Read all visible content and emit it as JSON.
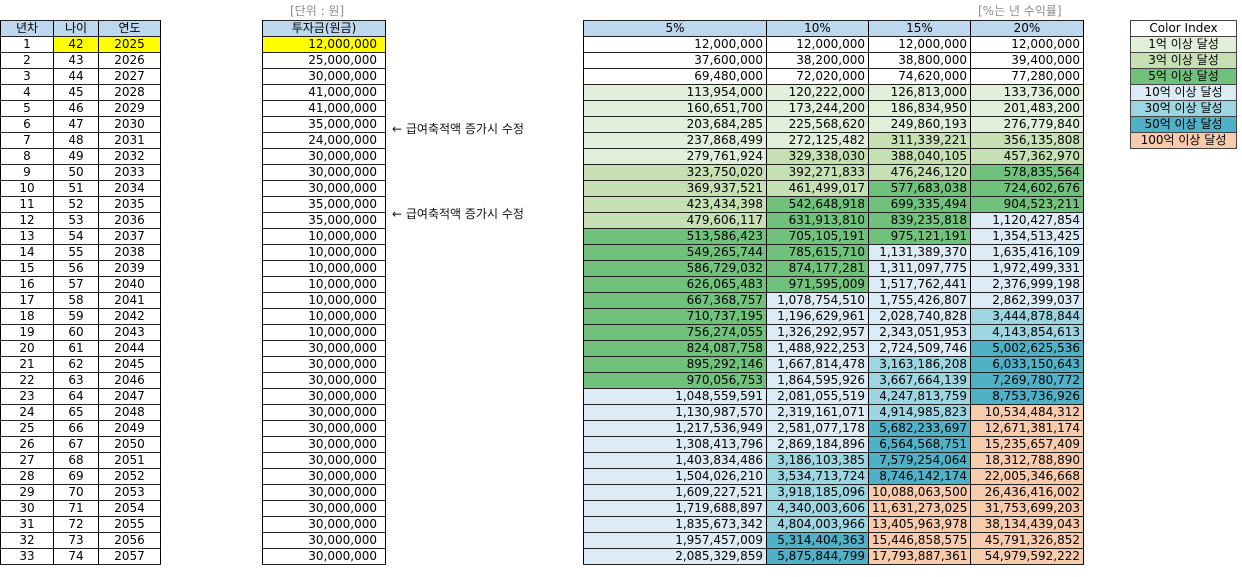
{
  "notes": {
    "unit": "[단위 : 원]",
    "pct": "[%는 년 수익률]"
  },
  "headers": {
    "year_no": "년차",
    "age": "나이",
    "year": "연도",
    "invest": "투자금(원금)",
    "rates": [
      "5%",
      "10%",
      "15%",
      "20%"
    ]
  },
  "side_notes": [
    {
      "row": 6,
      "text": "← 급여축적액 증가시 수정"
    },
    {
      "row": 11,
      "text": "← 급여축적액 증가시 수정"
    }
  ],
  "colors": {
    "1억": "#e2efda",
    "3억": "#c6e0b4",
    "5억": "#70c17c",
    "10억": "#ddebf7",
    "30억": "#9dd5e0",
    "50억": "#4fb0c6",
    "100억": "#f8cbad",
    "header": "#bdd7ee",
    "highlight": "#ffff00"
  },
  "color_index": {
    "title": "Color Index",
    "items": [
      {
        "key": "1억",
        "label": "1억 이상 달성"
      },
      {
        "key": "3억",
        "label": "3억 이상 달성"
      },
      {
        "key": "5억",
        "label": "5억 이상 달성"
      },
      {
        "key": "10억",
        "label": "10억 이상 달성"
      },
      {
        "key": "30억",
        "label": "30억 이상 달성"
      },
      {
        "key": "50억",
        "label": "50억 이상 달성"
      },
      {
        "key": "100억",
        "label": "100억 이상 달성"
      }
    ]
  },
  "rows": [
    {
      "n": "1",
      "age": "42",
      "year": "2025",
      "invest": "12,000,000",
      "hl": true,
      "v": [
        [
          "12,000,000",
          ""
        ],
        [
          "12,000,000",
          ""
        ],
        [
          "12,000,000",
          ""
        ],
        [
          "12,000,000",
          ""
        ]
      ]
    },
    {
      "n": "2",
      "age": "43",
      "year": "2026",
      "invest": "25,000,000",
      "v": [
        [
          "37,600,000",
          ""
        ],
        [
          "38,200,000",
          ""
        ],
        [
          "38,800,000",
          ""
        ],
        [
          "39,400,000",
          ""
        ]
      ]
    },
    {
      "n": "3",
      "age": "44",
      "year": "2027",
      "invest": "30,000,000",
      "v": [
        [
          "69,480,000",
          ""
        ],
        [
          "72,020,000",
          ""
        ],
        [
          "74,620,000",
          ""
        ],
        [
          "77,280,000",
          ""
        ]
      ]
    },
    {
      "n": "4",
      "age": "45",
      "year": "2028",
      "invest": "41,000,000",
      "v": [
        [
          "113,954,000",
          "1억"
        ],
        [
          "120,222,000",
          "1억"
        ],
        [
          "126,813,000",
          "1억"
        ],
        [
          "133,736,000",
          "1억"
        ]
      ]
    },
    {
      "n": "5",
      "age": "46",
      "year": "2029",
      "invest": "41,000,000",
      "v": [
        [
          "160,651,700",
          "1억"
        ],
        [
          "173,244,200",
          "1억"
        ],
        [
          "186,834,950",
          "1억"
        ],
        [
          "201,483,200",
          "1억"
        ]
      ]
    },
    {
      "n": "6",
      "age": "47",
      "year": "2030",
      "invest": "35,000,000",
      "v": [
        [
          "203,684,285",
          "1억"
        ],
        [
          "225,568,620",
          "1억"
        ],
        [
          "249,860,193",
          "1억"
        ],
        [
          "276,779,840",
          "1억"
        ]
      ]
    },
    {
      "n": "7",
      "age": "48",
      "year": "2031",
      "invest": "24,000,000",
      "v": [
        [
          "237,868,499",
          "1억"
        ],
        [
          "272,125,482",
          "1억"
        ],
        [
          "311,339,221",
          "3억"
        ],
        [
          "356,135,808",
          "3억"
        ]
      ]
    },
    {
      "n": "8",
      "age": "49",
      "year": "2032",
      "invest": "30,000,000",
      "v": [
        [
          "279,761,924",
          "1억"
        ],
        [
          "329,338,030",
          "3억"
        ],
        [
          "388,040,105",
          "3억"
        ],
        [
          "457,362,970",
          "3억"
        ]
      ]
    },
    {
      "n": "9",
      "age": "50",
      "year": "2033",
      "invest": "30,000,000",
      "v": [
        [
          "323,750,020",
          "3억"
        ],
        [
          "392,271,833",
          "3억"
        ],
        [
          "476,246,120",
          "3억"
        ],
        [
          "578,835,564",
          "5억"
        ]
      ]
    },
    {
      "n": "10",
      "age": "51",
      "year": "2034",
      "invest": "30,000,000",
      "v": [
        [
          "369,937,521",
          "3억"
        ],
        [
          "461,499,017",
          "3억"
        ],
        [
          "577,683,038",
          "5억"
        ],
        [
          "724,602,676",
          "5억"
        ]
      ]
    },
    {
      "n": "11",
      "age": "52",
      "year": "2035",
      "invest": "35,000,000",
      "v": [
        [
          "423,434,398",
          "3억"
        ],
        [
          "542,648,918",
          "5억"
        ],
        [
          "699,335,494",
          "5억"
        ],
        [
          "904,523,211",
          "5억"
        ]
      ]
    },
    {
      "n": "12",
      "age": "53",
      "year": "2036",
      "invest": "35,000,000",
      "v": [
        [
          "479,606,117",
          "3억"
        ],
        [
          "631,913,810",
          "5억"
        ],
        [
          "839,235,818",
          "5억"
        ],
        [
          "1,120,427,854",
          "10억"
        ]
      ]
    },
    {
      "n": "13",
      "age": "54",
      "year": "2037",
      "invest": "10,000,000",
      "v": [
        [
          "513,586,423",
          "5억"
        ],
        [
          "705,105,191",
          "5억"
        ],
        [
          "975,121,191",
          "5억"
        ],
        [
          "1,354,513,425",
          "10억"
        ]
      ]
    },
    {
      "n": "14",
      "age": "55",
      "year": "2038",
      "invest": "10,000,000",
      "v": [
        [
          "549,265,744",
          "5억"
        ],
        [
          "785,615,710",
          "5억"
        ],
        [
          "1,131,389,370",
          "10억"
        ],
        [
          "1,635,416,109",
          "10억"
        ]
      ]
    },
    {
      "n": "15",
      "age": "56",
      "year": "2039",
      "invest": "10,000,000",
      "v": [
        [
          "586,729,032",
          "5억"
        ],
        [
          "874,177,281",
          "5억"
        ],
        [
          "1,311,097,775",
          "10억"
        ],
        [
          "1,972,499,331",
          "10억"
        ]
      ]
    },
    {
      "n": "16",
      "age": "57",
      "year": "2040",
      "invest": "10,000,000",
      "v": [
        [
          "626,065,483",
          "5억"
        ],
        [
          "971,595,009",
          "5억"
        ],
        [
          "1,517,762,441",
          "10억"
        ],
        [
          "2,376,999,198",
          "10억"
        ]
      ]
    },
    {
      "n": "17",
      "age": "58",
      "year": "2041",
      "invest": "10,000,000",
      "v": [
        [
          "667,368,757",
          "5억"
        ],
        [
          "1,078,754,510",
          "10억"
        ],
        [
          "1,755,426,807",
          "10억"
        ],
        [
          "2,862,399,037",
          "10억"
        ]
      ]
    },
    {
      "n": "18",
      "age": "59",
      "year": "2042",
      "invest": "10,000,000",
      "v": [
        [
          "710,737,195",
          "5억"
        ],
        [
          "1,196,629,961",
          "10억"
        ],
        [
          "2,028,740,828",
          "10억"
        ],
        [
          "3,444,878,844",
          "30억"
        ]
      ]
    },
    {
      "n": "19",
      "age": "60",
      "year": "2043",
      "invest": "10,000,000",
      "v": [
        [
          "756,274,055",
          "5억"
        ],
        [
          "1,326,292,957",
          "10억"
        ],
        [
          "2,343,051,953",
          "10억"
        ],
        [
          "4,143,854,613",
          "30억"
        ]
      ]
    },
    {
      "n": "20",
      "age": "61",
      "year": "2044",
      "invest": "30,000,000",
      "v": [
        [
          "824,087,758",
          "5억"
        ],
        [
          "1,488,922,253",
          "10억"
        ],
        [
          "2,724,509,746",
          "10억"
        ],
        [
          "5,002,625,536",
          "50억"
        ]
      ]
    },
    {
      "n": "21",
      "age": "62",
      "year": "2045",
      "invest": "30,000,000",
      "v": [
        [
          "895,292,146",
          "5억"
        ],
        [
          "1,667,814,478",
          "10억"
        ],
        [
          "3,163,186,208",
          "30억"
        ],
        [
          "6,033,150,643",
          "50억"
        ]
      ]
    },
    {
      "n": "22",
      "age": "63",
      "year": "2046",
      "invest": "30,000,000",
      "v": [
        [
          "970,056,753",
          "5억"
        ],
        [
          "1,864,595,926",
          "10억"
        ],
        [
          "3,667,664,139",
          "30억"
        ],
        [
          "7,269,780,772",
          "50억"
        ]
      ]
    },
    {
      "n": "23",
      "age": "64",
      "year": "2047",
      "invest": "30,000,000",
      "v": [
        [
          "1,048,559,591",
          "10억"
        ],
        [
          "2,081,055,519",
          "10억"
        ],
        [
          "4,247,813,759",
          "30억"
        ],
        [
          "8,753,736,926",
          "50억"
        ]
      ]
    },
    {
      "n": "24",
      "age": "65",
      "year": "2048",
      "invest": "30,000,000",
      "v": [
        [
          "1,130,987,570",
          "10억"
        ],
        [
          "2,319,161,071",
          "10억"
        ],
        [
          "4,914,985,823",
          "30억"
        ],
        [
          "10,534,484,312",
          "100억"
        ]
      ]
    },
    {
      "n": "25",
      "age": "66",
      "year": "2049",
      "invest": "30,000,000",
      "v": [
        [
          "1,217,536,949",
          "10억"
        ],
        [
          "2,581,077,178",
          "10억"
        ],
        [
          "5,682,233,697",
          "50억"
        ],
        [
          "12,671,381,174",
          "100억"
        ]
      ]
    },
    {
      "n": "26",
      "age": "67",
      "year": "2050",
      "invest": "30,000,000",
      "v": [
        [
          "1,308,413,796",
          "10억"
        ],
        [
          "2,869,184,896",
          "10억"
        ],
        [
          "6,564,568,751",
          "50억"
        ],
        [
          "15,235,657,409",
          "100억"
        ]
      ]
    },
    {
      "n": "27",
      "age": "68",
      "year": "2051",
      "invest": "30,000,000",
      "v": [
        [
          "1,403,834,486",
          "10억"
        ],
        [
          "3,186,103,385",
          "30억"
        ],
        [
          "7,579,254,064",
          "50억"
        ],
        [
          "18,312,788,890",
          "100억"
        ]
      ]
    },
    {
      "n": "28",
      "age": "69",
      "year": "2052",
      "invest": "30,000,000",
      "v": [
        [
          "1,504,026,210",
          "10억"
        ],
        [
          "3,534,713,724",
          "30억"
        ],
        [
          "8,746,142,174",
          "50억"
        ],
        [
          "22,005,346,668",
          "100억"
        ]
      ]
    },
    {
      "n": "29",
      "age": "70",
      "year": "2053",
      "invest": "30,000,000",
      "v": [
        [
          "1,609,227,521",
          "10억"
        ],
        [
          "3,918,185,096",
          "30억"
        ],
        [
          "10,088,063,500",
          "100억"
        ],
        [
          "26,436,416,002",
          "100억"
        ]
      ]
    },
    {
      "n": "30",
      "age": "71",
      "year": "2054",
      "invest": "30,000,000",
      "v": [
        [
          "1,719,688,897",
          "10억"
        ],
        [
          "4,340,003,606",
          "30억"
        ],
        [
          "11,631,273,025",
          "100억"
        ],
        [
          "31,753,699,203",
          "100억"
        ]
      ]
    },
    {
      "n": "31",
      "age": "72",
      "year": "2055",
      "invest": "30,000,000",
      "v": [
        [
          "1,835,673,342",
          "10억"
        ],
        [
          "4,804,003,966",
          "30억"
        ],
        [
          "13,405,963,978",
          "100억"
        ],
        [
          "38,134,439,043",
          "100억"
        ]
      ]
    },
    {
      "n": "32",
      "age": "73",
      "year": "2056",
      "invest": "30,000,000",
      "v": [
        [
          "1,957,457,009",
          "10억"
        ],
        [
          "5,314,404,363",
          "50억"
        ],
        [
          "15,446,858,575",
          "100억"
        ],
        [
          "45,791,326,852",
          "100억"
        ]
      ]
    },
    {
      "n": "33",
      "age": "74",
      "year": "2057",
      "invest": "30,000,000",
      "v": [
        [
          "2,085,329,859",
          "10억"
        ],
        [
          "5,875,844,799",
          "50억"
        ],
        [
          "17,793,887,361",
          "100억"
        ],
        [
          "54,979,592,222",
          "100억"
        ]
      ]
    }
  ]
}
